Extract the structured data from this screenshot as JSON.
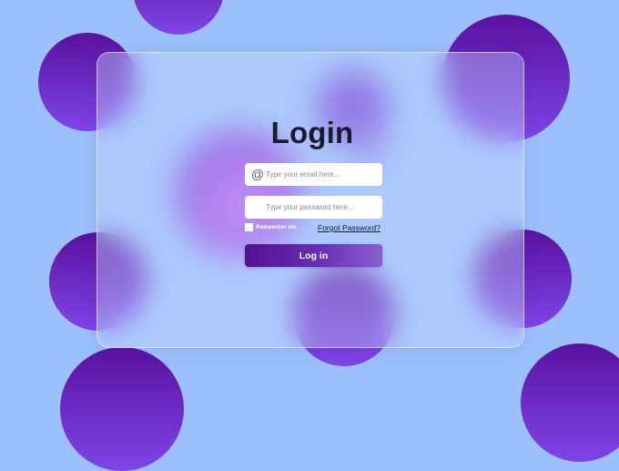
{
  "colors": {
    "background": "#9cc0fb",
    "bubble_top": "#5a11a0",
    "bubble_bottom": "#7f45e8",
    "button_start": "#55118f",
    "button_end": "#8a5ed0",
    "title_text": "#1b1b2e"
  },
  "login": {
    "title": "Login",
    "email": {
      "icon": "at-sign-icon",
      "icon_glyph": "@",
      "placeholder": "Type your email here...",
      "value": ""
    },
    "password": {
      "placeholder": "Type your password here...",
      "value": ""
    },
    "remember_label": "Remember me",
    "remember_checked": false,
    "forgot_label": "Forgot Password?",
    "submit_label": "Log in"
  }
}
